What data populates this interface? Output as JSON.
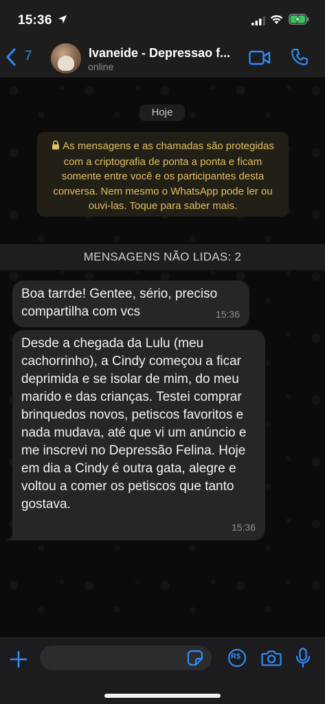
{
  "status_bar": {
    "time": "15:36"
  },
  "header": {
    "back_count": "7",
    "contact_name": "Ivaneide - Depressao f...",
    "contact_status": "online"
  },
  "chat": {
    "date_label": "Hoje",
    "encryption_note": "As mensagens e as chamadas são protegidas com a criptografia de ponta a ponta e ficam somente entre você e os participantes desta conversa. Nem mesmo o WhatsApp pode ler ou ouvi-las. Toque para saber mais.",
    "unread_label": "MENSAGENS NÃO LIDAS: 2",
    "messages": [
      {
        "text": "Boa tarrde! Gentee, sério, preciso compartilha com vcs",
        "time": "15:36"
      },
      {
        "text": "Desde a chegada da Lulu (meu cachorrinho), a Cindy começou a ficar deprimida e se isolar de mim, do meu marido e das crianças. Testei comprar brinquedos novos, petiscos favoritos e nada mudava, até que vi um anúncio e me inscrevi no Depressão Felina. Hoje em dia a Cindy é outra gata, alegre e voltou a comer os petiscos que tanto gostava.",
        "time": "15:36"
      }
    ]
  },
  "input_bar": {
    "placeholder": "",
    "pay_label": "R$"
  },
  "colors": {
    "accent": "#2f8cf7",
    "bubble": "#262628",
    "encryption_text": "#e2c063"
  }
}
